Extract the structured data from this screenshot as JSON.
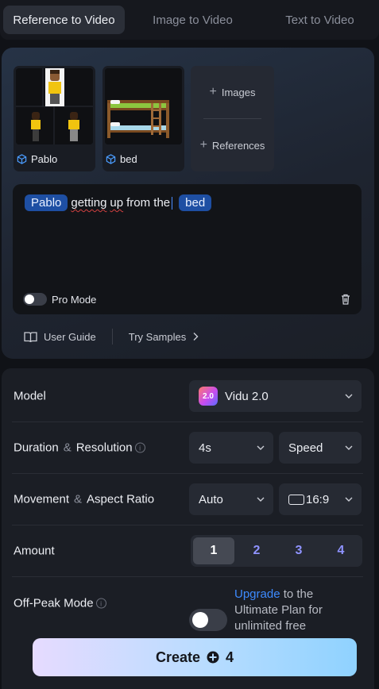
{
  "tabs": [
    {
      "label": "Reference to Video",
      "active": true
    },
    {
      "label": "Image to Video",
      "active": false
    },
    {
      "label": "Text to Video",
      "active": false
    }
  ],
  "references": [
    {
      "name": "Pablo"
    },
    {
      "name": "bed"
    }
  ],
  "add_card": {
    "images_label": "Images",
    "references_label": "References"
  },
  "prompt": {
    "chip1": "Pablo",
    "text_a": "getting",
    "text_b": "up",
    "text_c": "from the",
    "chip2": "bed"
  },
  "pro_mode": {
    "label": "Pro Mode",
    "enabled": false
  },
  "links": {
    "user_guide": "User Guide",
    "try_samples": "Try Samples"
  },
  "settings": {
    "model": {
      "label": "Model",
      "value": "Vidu 2.0",
      "logo_text": "2.0"
    },
    "duration_resolution": {
      "label_a": "Duration",
      "amp": "&",
      "label_b": "Resolution",
      "duration": "4s",
      "resolution": "Speed"
    },
    "movement_ratio": {
      "label_a": "Movement",
      "amp": "&",
      "label_b": "Aspect Ratio",
      "movement": "Auto",
      "ratio": "16:9"
    },
    "amount": {
      "label": "Amount",
      "options": [
        "1",
        "2",
        "3",
        "4"
      ],
      "selected": "1"
    },
    "off_peak": {
      "label": "Off-Peak Mode",
      "enabled": false,
      "upgrade_link": "Upgrade",
      "text_rest": " to the Ultimate Plan for unlimited free"
    }
  },
  "create_button": {
    "label": "Create",
    "credits": "4"
  },
  "colors": {
    "accent": "#3d8bff",
    "chip": "#1e4fa3",
    "amount_text": "#8f93ff"
  }
}
